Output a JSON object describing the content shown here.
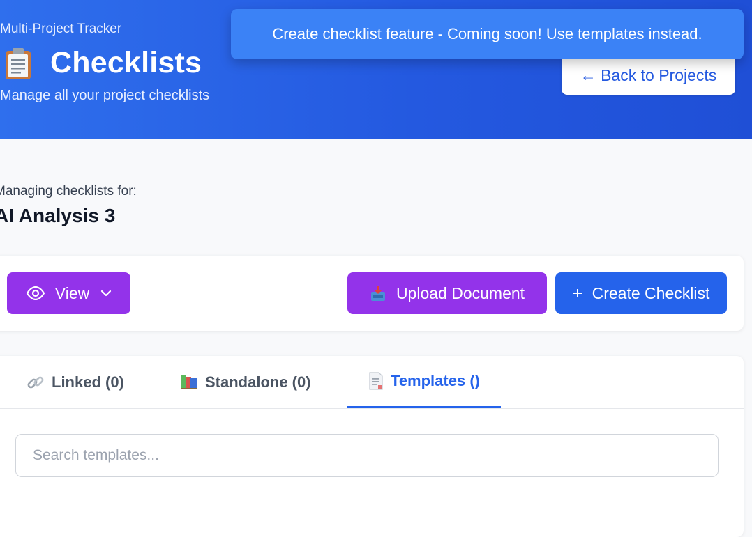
{
  "header": {
    "app_name": "Multi-Project Tracker",
    "title": "Checklists",
    "subtitle": "Manage all your project checklists",
    "back_button": "← Back to Projects"
  },
  "toast": {
    "message": "Create checklist feature - Coming soon! Use templates instead."
  },
  "context": {
    "label": "Managing checklists for:",
    "project_name": "AI Analysis 3"
  },
  "toolbar": {
    "view_label": "View",
    "upload_label": "Upload Document",
    "create_label": "Create Checklist"
  },
  "tabs": [
    {
      "label": "Linked (0)",
      "icon": "link-icon",
      "active": false
    },
    {
      "label": "Standalone (0)",
      "icon": "books-icon",
      "active": false
    },
    {
      "label": "Templates ()",
      "icon": "document-icon",
      "active": true
    }
  ],
  "search": {
    "placeholder": "Search templates..."
  },
  "colors": {
    "header_blue": "#2459e0",
    "toast_blue": "#3b82f6",
    "purple": "#9333ea",
    "primary_blue": "#2563eb"
  }
}
